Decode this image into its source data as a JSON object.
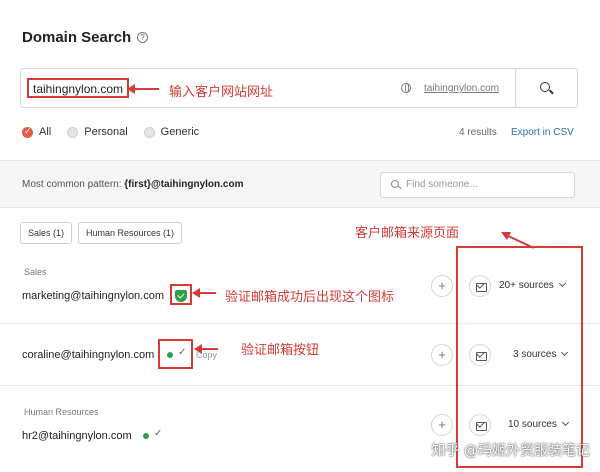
{
  "header": {
    "title": "Domain Search",
    "help_icon": "question-circle-icon"
  },
  "search": {
    "value": "taihingnylon.com",
    "domain_link": "taihingnylon.com",
    "globe_icon": "globe-icon",
    "button_icon": "search-icon"
  },
  "filters": {
    "options": [
      "All",
      "Personal",
      "Generic"
    ],
    "selected": "All",
    "results_count": "4 results",
    "export_label": "Export in CSV"
  },
  "pattern": {
    "label": "Most common pattern:",
    "value": "{first}@taihingnylon.com",
    "find_placeholder": "Find someone..."
  },
  "chips": [
    "Sales (1)",
    "Human Resources (1)"
  ],
  "emails": [
    {
      "group": "Sales",
      "address": "marketing@taihingnylon.com",
      "status": "verified-shield",
      "sources": "20+ sources"
    },
    {
      "group": "",
      "address": "coraline@taihingnylon.com",
      "status": "dot-check",
      "copy_label": "Copy",
      "sources": "3 sources"
    },
    {
      "group": "Human Resources",
      "address": "hr2@taihingnylon.com",
      "status": "dot-check",
      "sources": "10 sources"
    }
  ],
  "annotations": {
    "search_note": "输入客户网站网址",
    "sources_note": "客户邮箱来源页面",
    "verified_note": "验证邮箱成功后出现这个图标",
    "verify_button_note": "验证邮箱按钮",
    "annotation_color": "#d43b35"
  },
  "watermark": "知乎 @玛姬外贸服装笔记",
  "colors": {
    "accent": "#e25d43",
    "link": "#2b6fa8",
    "verified": "#2f9e4b"
  }
}
